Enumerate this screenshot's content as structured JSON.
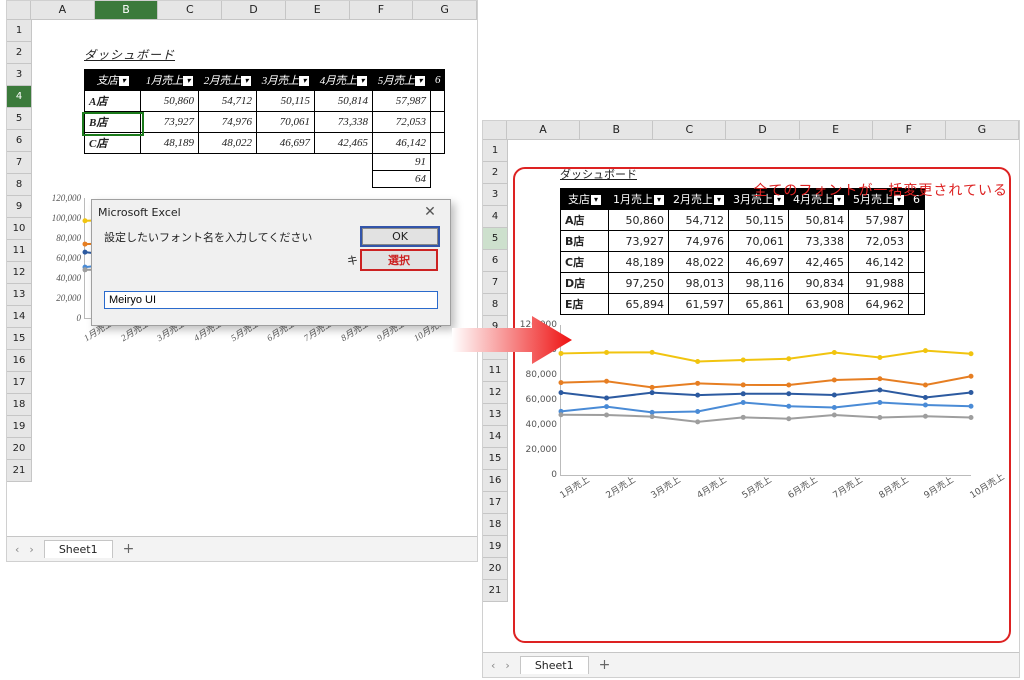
{
  "left_title": "ダッシュボード",
  "right_title": "ダッシュボード",
  "annotation": "全てのフォントが一括変更されている",
  "col_letters": [
    "A",
    "B",
    "C",
    "D",
    "E",
    "F",
    "G"
  ],
  "left_rows": [
    1,
    2,
    3,
    4,
    5,
    6,
    7,
    8,
    9,
    10,
    11,
    12,
    13,
    14,
    15,
    16,
    17,
    18,
    19,
    20,
    21
  ],
  "right_rows": [
    1,
    2,
    3,
    4,
    5,
    6,
    7,
    8,
    9,
    10,
    11,
    12,
    13,
    14,
    15,
    16,
    17,
    18,
    19,
    20,
    21
  ],
  "left_sel_row": 4,
  "left_sel_col": "B",
  "right_sel_row": 5,
  "headers_left": [
    "支店",
    "1月売上",
    "2月売上",
    "3月売上",
    "4月売上",
    "5月売上",
    "6"
  ],
  "headers_right": [
    "支店",
    "1月売上",
    "2月売上",
    "3月売上",
    "4月売上",
    "5月売上",
    "6"
  ],
  "rows": [
    {
      "lbl": "A店",
      "v": [
        "50,860",
        "54,712",
        "50,115",
        "50,814",
        "57,987"
      ]
    },
    {
      "lbl": "B店",
      "v": [
        "73,927",
        "74,976",
        "70,061",
        "73,338",
        "72,053"
      ]
    },
    {
      "lbl": "C店",
      "v": [
        "48,189",
        "48,022",
        "46,697",
        "42,465",
        "46,142"
      ]
    },
    {
      "lbl": "D店",
      "v": [
        "97,250",
        "98,013",
        "98,116",
        "90,834",
        "91,988"
      ]
    },
    {
      "lbl": "E店",
      "v": [
        "65,894",
        "61,597",
        "65,861",
        "63,908",
        "64,962"
      ]
    }
  ],
  "left_tail": [
    "91",
    "64"
  ],
  "dialog": {
    "title": "Microsoft Excel",
    "prompt": "設定したいフォント名を入力してください",
    "ok": "OK",
    "cancel_prefix": "キ",
    "select": "選択",
    "value": "Meiryo UI"
  },
  "sheet_tab": "Sheet1",
  "chart_data": {
    "type": "line",
    "ylim": [
      0,
      120000
    ],
    "yticks": [
      0,
      20000,
      40000,
      60000,
      80000,
      100000,
      120000
    ],
    "yticklabels": [
      "0",
      "20,000",
      "40,000",
      "60,000",
      "80,000",
      "100,000",
      "120,000"
    ],
    "categories": [
      "1月売上",
      "2月売上",
      "3月売上",
      "4月売上",
      "5月売上",
      "6月売上",
      "7月売上",
      "8月売上",
      "9月売上",
      "10月売上"
    ],
    "series": [
      {
        "name": "A店",
        "color": "#4a8bd6",
        "values": [
          50860,
          54712,
          50115,
          50814,
          57987,
          55000,
          54000,
          58000,
          56000,
          55000
        ]
      },
      {
        "name": "B店",
        "color": "#e67e22",
        "values": [
          73927,
          74976,
          70061,
          73338,
          72053,
          72000,
          76000,
          77000,
          72000,
          79000
        ]
      },
      {
        "name": "C店",
        "color": "#9e9e9e",
        "values": [
          48189,
          48022,
          46697,
          42465,
          46142,
          45000,
          48000,
          46000,
          47000,
          46000
        ]
      },
      {
        "name": "D店",
        "color": "#f1c40f",
        "values": [
          97250,
          98013,
          98116,
          90834,
          91988,
          93000,
          98000,
          94000,
          99500,
          97000
        ]
      },
      {
        "name": "E店",
        "color": "#2c5aa0",
        "values": [
          65894,
          61597,
          65861,
          63908,
          64962,
          65000,
          64000,
          68000,
          62000,
          66000
        ]
      }
    ]
  }
}
